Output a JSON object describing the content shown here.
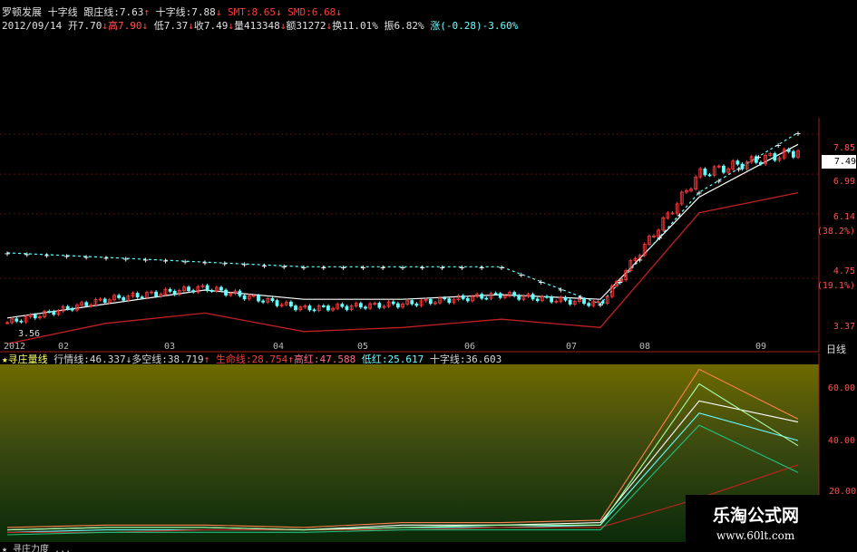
{
  "header": {
    "stock_name": "罗顿发展",
    "ind1_label": "十字线",
    "gz_label": "跟庄线:",
    "gz_value": "7.63",
    "sz_label": "十字线:",
    "sz_value": "7.88",
    "smt": "SMT:8.65",
    "smd": "SMD:6.68",
    "date": "2012/09/14",
    "open_label": "开",
    "open": "7.70",
    "high_label": "高",
    "high": "7.90",
    "low_label": "低",
    "low": "7.37",
    "close_label": "收",
    "close": "7.49",
    "vol_label": "量",
    "vol": "413348",
    "amt_label": "额",
    "amt": "31272",
    "turn": "换11.01%",
    "swing": "振6.82%",
    "chg": "涨(-0.28)-3.60%"
  },
  "price_axis": {
    "ticks": [
      "7.85",
      "6.99",
      "6.14",
      "(38.2%)",
      "4.75",
      "(19.1%)",
      "3.37"
    ],
    "current_tag": "7.49",
    "low_label": "3.56",
    "timeframe": "日线"
  },
  "months": [
    "2012",
    "02",
    "03",
    "04",
    "05",
    "06",
    "07",
    "08",
    "09"
  ],
  "sub": {
    "title": "★寻庄量线",
    "hq_label": "行情线:",
    "hq_value": "46.337",
    "dk_label": "多空线:",
    "dk_value": "38.719",
    "sm_label": "生命线:",
    "sm_value": "28.754",
    "gh_label": "高红:",
    "gh_value": "47.588",
    "dh_label": "低红:",
    "dh_value": "25.617",
    "sz_label": "十字线:",
    "sz_value": "36.603",
    "axis": [
      "60.00",
      "40.00",
      "20.00"
    ]
  },
  "bottom_row": "★ 寻庄力度 ...",
  "brand": {
    "name": "乐淘公式网",
    "url": "www.60lt.com"
  },
  "colors": {
    "up": "#ff3a3a",
    "down": "#66ffff",
    "ma": "#ffffff",
    "life": "#c02020"
  },
  "chart_data": [
    {
      "type": "candlestick",
      "title": "罗顿发展",
      "x": [
        "2012-01",
        "2012-02",
        "2012-03",
        "2012-04",
        "2012-05",
        "2012-06",
        "2012-07",
        "2012-08",
        "2012-09"
      ],
      "close": [
        3.8,
        4.3,
        4.55,
        4.1,
        4.2,
        4.4,
        4.2,
        7.0,
        7.49
      ],
      "ylim": [
        3.37,
        8.2
      ],
      "series": [
        {
          "name": "跟庄线",
          "values": [
            3.9,
            4.2,
            4.5,
            4.3,
            4.3,
            4.4,
            4.3,
            6.5,
            7.63
          ]
        },
        {
          "name": "十字线",
          "values": [
            5.3,
            5.2,
            5.1,
            5.0,
            5.0,
            5.0,
            4.2,
            6.6,
            7.88
          ]
        }
      ]
    },
    {
      "type": "line",
      "title": "★寻庄量线",
      "x": [
        "2012-01",
        "2012-02",
        "2012-03",
        "2012-04",
        "2012-05",
        "2012-06",
        "2012-07",
        "2012-08",
        "2012-09"
      ],
      "ylim": [
        0,
        70
      ],
      "series": [
        {
          "name": "行情线",
          "values": [
            2,
            3,
            3,
            2,
            4,
            4,
            5,
            55,
            46.337
          ]
        },
        {
          "name": "多空线",
          "values": [
            1,
            2,
            2,
            2,
            3,
            3,
            4,
            50,
            38.719
          ]
        },
        {
          "name": "生命线",
          "values": [
            1,
            1,
            2,
            2,
            2,
            3,
            3,
            15,
            28.754
          ]
        },
        {
          "name": "高红",
          "values": [
            3,
            4,
            4,
            3,
            5,
            5,
            6,
            68,
            47.588
          ]
        },
        {
          "name": "低红",
          "values": [
            0,
            1,
            1,
            1,
            2,
            2,
            2,
            45,
            25.617
          ]
        },
        {
          "name": "十字线",
          "values": [
            2,
            3,
            3,
            2,
            3,
            4,
            4,
            62,
            36.603
          ]
        }
      ]
    }
  ]
}
